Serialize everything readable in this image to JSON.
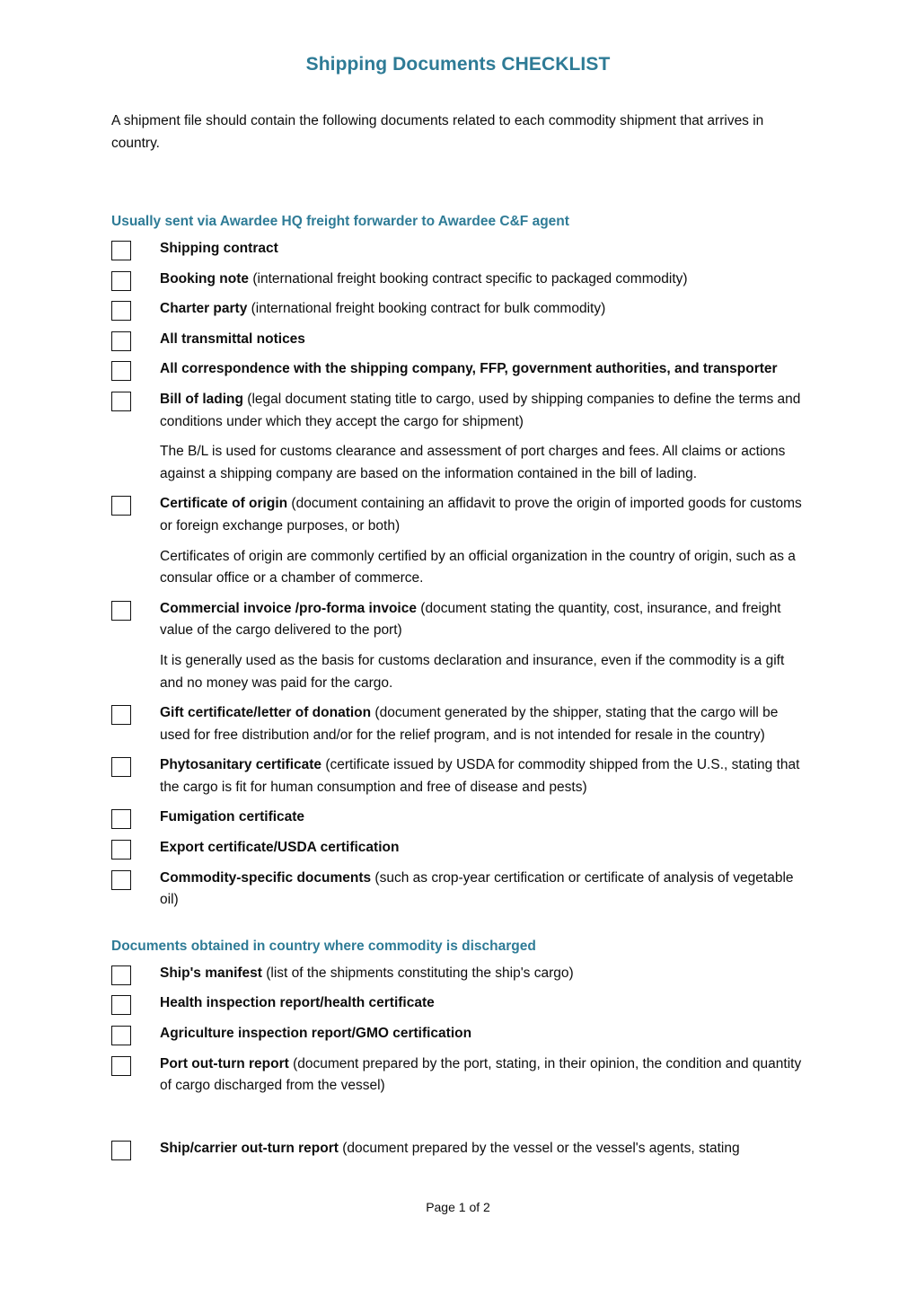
{
  "document": {
    "title": "Shipping Documents CHECKLIST",
    "intro": "A shipment file should contain the following documents related to each commodity shipment that arrives in country.",
    "footer": "Page 1 of 2",
    "accent_color": "#2e7b96",
    "text_color": "#0d0d0d"
  },
  "sections": [
    {
      "heading": "Usually sent via Awardee HQ freight forwarder to Awardee C&F agent",
      "items": [
        {
          "bold": "Shipping contract",
          "rest": ""
        },
        {
          "bold": "Booking note",
          "rest": " (international freight booking contract specific to packaged commodity)"
        },
        {
          "bold": "Charter party",
          "rest": " (international freight booking contract for bulk commodity)"
        },
        {
          "bold": "All transmittal notices",
          "rest": ""
        },
        {
          "bold": "All correspondence with the shipping company, FFP, government authorities, and transporter",
          "rest": ""
        },
        {
          "bold": "Bill of lading",
          "rest": " (legal document stating title to cargo, used by shipping companies to define the terms and conditions under which they accept the cargo for shipment)",
          "note": "The B/L is used for customs clearance and assessment of port charges and fees. All claims or actions against a shipping company are based on the information contained in the bill of lading."
        },
        {
          "bold": "Certificate of origin",
          "rest": " (document containing an affidavit to prove the origin of imported goods for customs or foreign exchange purposes, or both)",
          "note": "Certificates of origin are commonly certified by an official organization in the country of origin, such as a consular office or a chamber of commerce."
        },
        {
          "bold": "Commercial invoice /pro-forma invoice",
          "rest": " (document stating the quantity, cost, insurance, and freight value of the cargo delivered to the port)",
          "note": "It is generally used as the basis for customs declaration and insurance, even if the commodity is a gift and no money was paid for the cargo."
        },
        {
          "bold": "Gift certificate/letter of donation",
          "rest": " (document generated by the shipper, stating that the cargo will be used for free distribution and/or for the relief program, and is not intended for resale in the country)"
        },
        {
          "bold": "Phytosanitary certificate",
          "rest": " (certificate issued by USDA for commodity shipped from the U.S., stating that the cargo is fit for human consumption and free of disease and pests)"
        },
        {
          "bold": "Fumigation certificate",
          "rest": ""
        },
        {
          "bold": "Export certificate/USDA certification",
          "rest": ""
        },
        {
          "bold": "Commodity-specific documents",
          "rest": " (such as crop-year certification or certificate of analysis of vegetable oil)"
        }
      ]
    },
    {
      "heading": "Documents obtained in country where commodity is discharged",
      "items": [
        {
          "bold": "Ship's manifest",
          "rest": " (list of the shipments constituting the ship's cargo)"
        },
        {
          "bold": "Health inspection report/health certificate",
          "rest": ""
        },
        {
          "bold": "Agriculture inspection report/GMO certification",
          "rest": ""
        },
        {
          "bold": "Port out-turn report",
          "rest": " (document prepared by the port, stating, in their opinion, the condition and quantity of cargo discharged from the vessel)",
          "gap_after": true
        },
        {
          "bold": "Ship/carrier out-turn report",
          "rest": " (document prepared by the vessel or the vessel's agents, stating"
        }
      ]
    }
  ]
}
